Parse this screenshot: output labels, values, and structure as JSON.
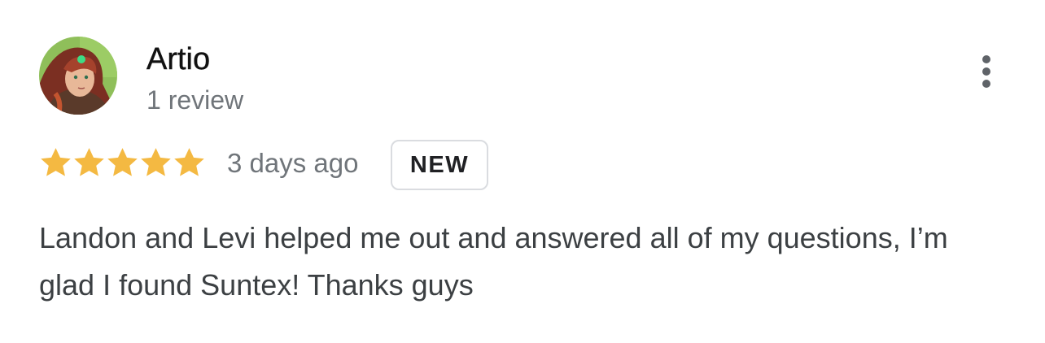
{
  "review": {
    "author": {
      "name": "Artio",
      "meta": "1 review",
      "avatar_icon": "avatar-illustration-icon"
    },
    "more_icon": "more-vertical-icon",
    "rating": {
      "stars": 5,
      "max_stars": 5,
      "star_color": "#f4b942"
    },
    "time_ago": "3 days ago",
    "badge": "NEW",
    "text": "Landon and Levi helped me out and answered all of my questions, I’m glad I found Suntex! Thanks guys"
  },
  "colors": {
    "name": "#111111",
    "secondary_text": "#70757a",
    "body_text": "#3c4043",
    "badge_border": "#dadce0",
    "star": "#f4b942"
  }
}
